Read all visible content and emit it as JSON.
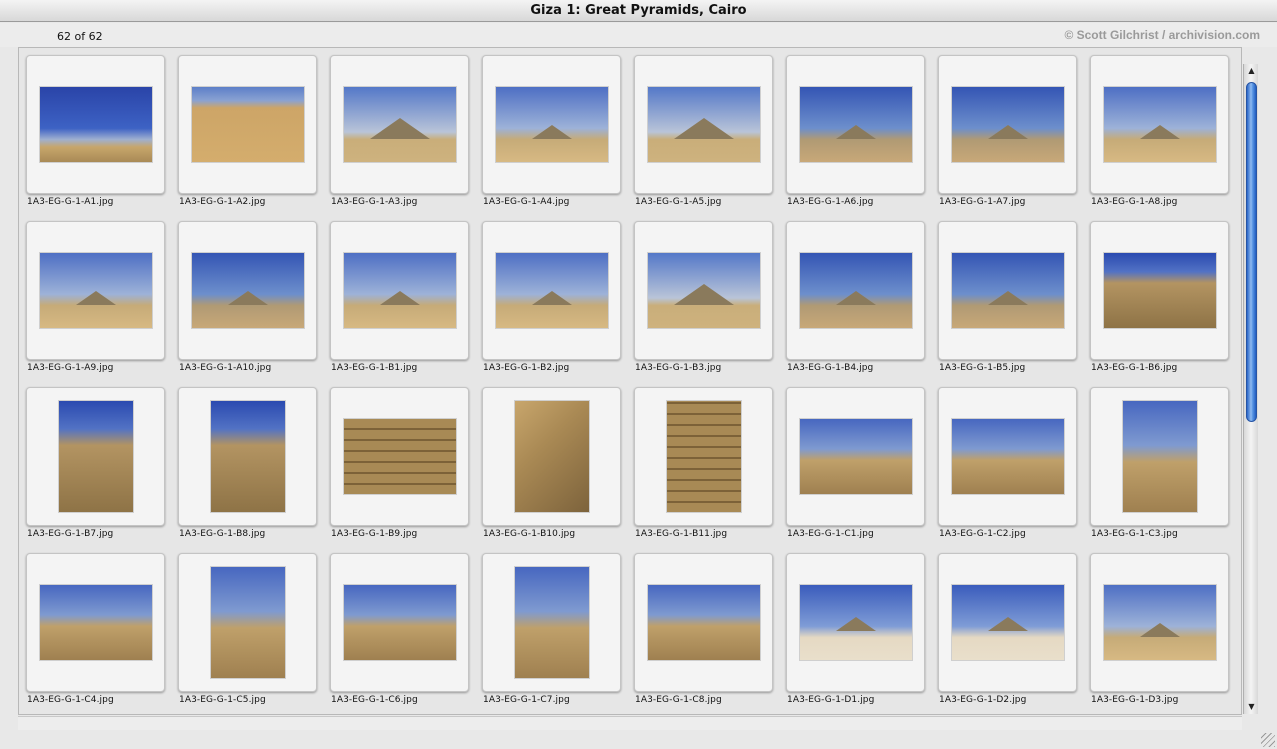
{
  "window": {
    "title": "Giza 1: Great Pyramids, Cairo",
    "count": "62 of 62",
    "credit": "© Scott Gilchrist / archivision.com"
  },
  "thumbnails": [
    {
      "file": "1A3-EG-G-1-A1.jpg",
      "style": "sky1",
      "orient": "landscape"
    },
    {
      "file": "1A3-EG-G-1-A2.jpg",
      "style": "sky2",
      "orient": "landscape"
    },
    {
      "file": "1A3-EG-G-1-A3.jpg",
      "style": "pyrB",
      "orient": "landscape"
    },
    {
      "file": "1A3-EG-G-1-A4.jpg",
      "style": "pyrA",
      "orient": "landscape"
    },
    {
      "file": "1A3-EG-G-1-A5.jpg",
      "style": "pyrB",
      "orient": "landscape"
    },
    {
      "file": "1A3-EG-G-1-A6.jpg",
      "style": "pyrC",
      "orient": "landscape"
    },
    {
      "file": "1A3-EG-G-1-A7.jpg",
      "style": "pyrC",
      "orient": "landscape"
    },
    {
      "file": "1A3-EG-G-1-A8.jpg",
      "style": "pyrA",
      "orient": "landscape"
    },
    {
      "file": "1A3-EG-G-1-A9.jpg",
      "style": "pyrA",
      "orient": "landscape"
    },
    {
      "file": "1A3-EG-G-1-A10.jpg",
      "style": "pyrC",
      "orient": "landscape"
    },
    {
      "file": "1A3-EG-G-1-B1.jpg",
      "style": "pyrA",
      "orient": "landscape"
    },
    {
      "file": "1A3-EG-G-1-B2.jpg",
      "style": "pyrA",
      "orient": "landscape"
    },
    {
      "file": "1A3-EG-G-1-B3.jpg",
      "style": "pyrB",
      "orient": "landscape"
    },
    {
      "file": "1A3-EG-G-1-B4.jpg",
      "style": "pyrC",
      "orient": "landscape"
    },
    {
      "file": "1A3-EG-G-1-B5.jpg",
      "style": "pyrC",
      "orient": "landscape"
    },
    {
      "file": "1A3-EG-G-1-B6.jpg",
      "style": "tall",
      "orient": "landscape"
    },
    {
      "file": "1A3-EG-G-1-B7.jpg",
      "style": "tall",
      "orient": "portrait"
    },
    {
      "file": "1A3-EG-G-1-B8.jpg",
      "style": "tall",
      "orient": "portrait"
    },
    {
      "file": "1A3-EG-G-1-B9.jpg",
      "style": "stone",
      "orient": "landscape"
    },
    {
      "file": "1A3-EG-G-1-B10.jpg",
      "style": "stoneB",
      "orient": "portrait"
    },
    {
      "file": "1A3-EG-G-1-B11.jpg",
      "style": "stone",
      "orient": "portrait"
    },
    {
      "file": "1A3-EG-G-1-C1.jpg",
      "style": "ruins",
      "orient": "landscape"
    },
    {
      "file": "1A3-EG-G-1-C2.jpg",
      "style": "ruins",
      "orient": "landscape"
    },
    {
      "file": "1A3-EG-G-1-C3.jpg",
      "style": "ruins",
      "orient": "portrait"
    },
    {
      "file": "1A3-EG-G-1-C4.jpg",
      "style": "ruins",
      "orient": "landscape"
    },
    {
      "file": "1A3-EG-G-1-C5.jpg",
      "style": "ruins",
      "orient": "portrait"
    },
    {
      "file": "1A3-EG-G-1-C6.jpg",
      "style": "ruins",
      "orient": "landscape"
    },
    {
      "file": "1A3-EG-G-1-C7.jpg",
      "style": "ruins",
      "orient": "portrait"
    },
    {
      "file": "1A3-EG-G-1-C8.jpg",
      "style": "ruins",
      "orient": "landscape"
    },
    {
      "file": "1A3-EG-G-1-D1.jpg",
      "style": "sand",
      "orient": "landscape"
    },
    {
      "file": "1A3-EG-G-1-D2.jpg",
      "style": "sand",
      "orient": "landscape"
    },
    {
      "file": "1A3-EG-G-1-D3.jpg",
      "style": "pyrA",
      "orient": "landscape"
    }
  ],
  "scrollbar": {
    "up_icon": "▲",
    "down_icon": "▼"
  }
}
